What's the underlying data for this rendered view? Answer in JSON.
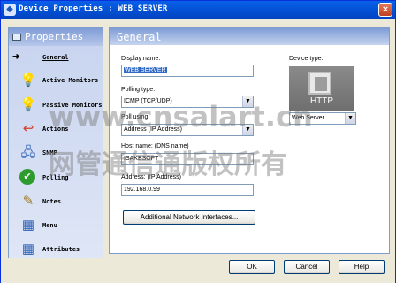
{
  "window": {
    "title": "Device Properties : WEB SERVER",
    "close_glyph": "×"
  },
  "sidebar": {
    "header": "Properties",
    "items": [
      {
        "label": "General",
        "icon": "→"
      },
      {
        "label": "Active Monitors",
        "icon": "💡"
      },
      {
        "label": "Passive Monitors",
        "icon": "💡"
      },
      {
        "label": "Actions",
        "icon": "↩"
      },
      {
        "label": "SNMP",
        "icon": "🖧"
      },
      {
        "label": "Polling",
        "icon": "✔"
      },
      {
        "label": "Notes",
        "icon": "✎"
      },
      {
        "label": "Menu",
        "icon": "▦"
      },
      {
        "label": "Attributes",
        "icon": "▦"
      }
    ]
  },
  "general": {
    "header": "General",
    "display_name_label": "Display name:",
    "display_name_value": "WEB SERVER",
    "polling_type_label": "Polling type:",
    "polling_type_value": "ICMP (TCP/UDP)",
    "poll_using_label": "Poll using:",
    "poll_using_value": "Address (IP Address)",
    "host_name_label": "Host name: (DNS name)",
    "host_name_value": "ISAKBSOFT",
    "address_label": "Address: (IP Address)",
    "address_value": "192.168.0.99",
    "additional_button": "Additional Network Interfaces...",
    "device_type_label": "Device type:",
    "device_image_text": "HTTP",
    "device_type_value": "Web Server"
  },
  "footer": {
    "ok": "OK",
    "cancel": "Cancel",
    "help": "Help"
  },
  "watermark": {
    "line1": "www.cnsalart.cn",
    "line2": "网管通信通版权所有"
  }
}
